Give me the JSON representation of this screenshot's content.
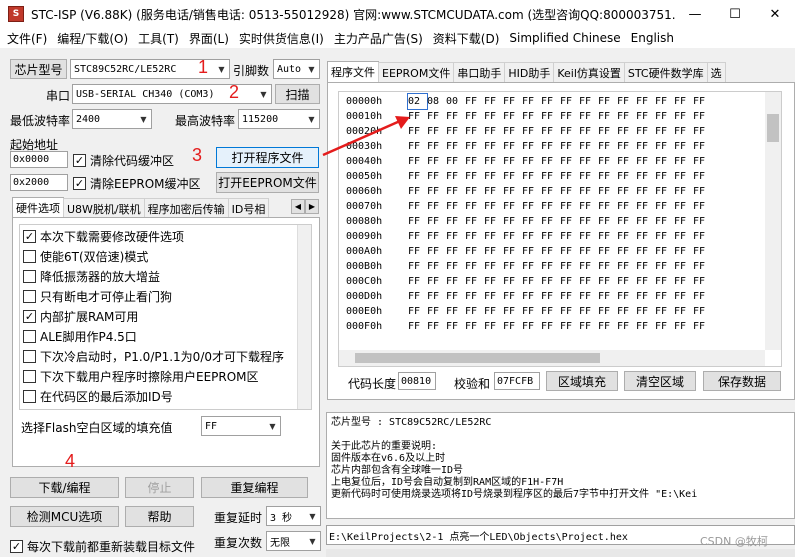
{
  "window": {
    "title": "STC-ISP (V6.88K) (服务电话/销售电话: 0513-55012928) 官网:www.STCMCUDATA.com  (选型咨询QQ:800003751...",
    "minimize": "—",
    "maximize": "☐",
    "close": "✕"
  },
  "menu": [
    "文件(F)",
    "编程/下载(O)",
    "工具(T)",
    "界面(L)",
    "实时供货信息(I)",
    "主力产品广告(S)",
    "资料下载(D)",
    "Simplified Chinese",
    "English"
  ],
  "left": {
    "chip_type_label": "芯片型号",
    "chip_type": "STC89C52RC/LE52RC",
    "pin_count_label": "引脚数",
    "pin_count": "Auto",
    "port_label": "串口",
    "port": "USB-SERIAL CH340 (COM3)",
    "scan": "扫描",
    "min_baud_label": "最低波特率",
    "min_baud": "2400",
    "max_baud_label": "最高波特率",
    "max_baud": "115200",
    "start_addr_label": "起始地址",
    "addr1": "0x0000",
    "clear_code": "清除代码缓冲区",
    "open_prog": "打开程序文件",
    "addr2": "0x2000",
    "clear_eeprom": "清除EEPROM缓冲区",
    "open_eeprom": "打开EEPROM文件",
    "tabs": [
      "硬件选项",
      "U8W脱机/联机",
      "程序加密后传输",
      "ID号相"
    ],
    "options": [
      {
        "label": "本次下载需要修改硬件选项",
        "checked": true
      },
      {
        "label": "使能6T(双倍速)模式",
        "checked": false
      },
      {
        "label": "降低振荡器的放大增益",
        "checked": false
      },
      {
        "label": "只有断电才可停止看门狗",
        "checked": false
      },
      {
        "label": "内部扩展RAM可用",
        "checked": true
      },
      {
        "label": "ALE脚用作P4.5口",
        "checked": false
      },
      {
        "label": "下次冷启动时，P1.0/P1.1为0/0才可下载程序",
        "checked": false
      },
      {
        "label": "下次下载用户程序时擦除用户EEPROM区",
        "checked": false
      },
      {
        "label": "在代码区的最后添加ID号",
        "checked": false
      }
    ],
    "fill_label": "选择Flash空白区域的填充值",
    "fill_value": "FF",
    "download": "下载/编程",
    "stop": "停止",
    "reprogram": "重复编程",
    "detect": "检测MCU选项",
    "help": "帮助",
    "delay_label": "重复延时",
    "delay": "3 秒",
    "reload": "每次下载前都重新装载目标文件",
    "count_label": "重复次数",
    "count": "无限"
  },
  "steps": [
    "1",
    "2",
    "3",
    "4"
  ],
  "right": {
    "tabs": [
      "程序文件",
      "EEPROM文件",
      "串口助手",
      "HID助手",
      "Keil仿真设置",
      "STC硬件数学库",
      "选"
    ],
    "hex_rows": [
      {
        "addr": "00000h",
        "bytes": [
          "02",
          "08",
          "00",
          "FF",
          "FF",
          "FF",
          "FF",
          "FF",
          "FF",
          "FF",
          "FF",
          "FF",
          "FF",
          "FF",
          "FF",
          "FF"
        ]
      },
      {
        "addr": "00010h",
        "bytes": [
          "FF",
          "FF",
          "FF",
          "FF",
          "FF",
          "FF",
          "FF",
          "FF",
          "FF",
          "FF",
          "FF",
          "FF",
          "FF",
          "FF",
          "FF",
          "FF"
        ]
      },
      {
        "addr": "00020h",
        "bytes": [
          "FF",
          "FF",
          "FF",
          "FF",
          "FF",
          "FF",
          "FF",
          "FF",
          "FF",
          "FF",
          "FF",
          "FF",
          "FF",
          "FF",
          "FF",
          "FF"
        ]
      },
      {
        "addr": "00030h",
        "bytes": [
          "FF",
          "FF",
          "FF",
          "FF",
          "FF",
          "FF",
          "FF",
          "FF",
          "FF",
          "FF",
          "FF",
          "FF",
          "FF",
          "FF",
          "FF",
          "FF"
        ]
      },
      {
        "addr": "00040h",
        "bytes": [
          "FF",
          "FF",
          "FF",
          "FF",
          "FF",
          "FF",
          "FF",
          "FF",
          "FF",
          "FF",
          "FF",
          "FF",
          "FF",
          "FF",
          "FF",
          "FF"
        ]
      },
      {
        "addr": "00050h",
        "bytes": [
          "FF",
          "FF",
          "FF",
          "FF",
          "FF",
          "FF",
          "FF",
          "FF",
          "FF",
          "FF",
          "FF",
          "FF",
          "FF",
          "FF",
          "FF",
          "FF"
        ]
      },
      {
        "addr": "00060h",
        "bytes": [
          "FF",
          "FF",
          "FF",
          "FF",
          "FF",
          "FF",
          "FF",
          "FF",
          "FF",
          "FF",
          "FF",
          "FF",
          "FF",
          "FF",
          "FF",
          "FF"
        ]
      },
      {
        "addr": "00070h",
        "bytes": [
          "FF",
          "FF",
          "FF",
          "FF",
          "FF",
          "FF",
          "FF",
          "FF",
          "FF",
          "FF",
          "FF",
          "FF",
          "FF",
          "FF",
          "FF",
          "FF"
        ]
      },
      {
        "addr": "00080h",
        "bytes": [
          "FF",
          "FF",
          "FF",
          "FF",
          "FF",
          "FF",
          "FF",
          "FF",
          "FF",
          "FF",
          "FF",
          "FF",
          "FF",
          "FF",
          "FF",
          "FF"
        ]
      },
      {
        "addr": "00090h",
        "bytes": [
          "FF",
          "FF",
          "FF",
          "FF",
          "FF",
          "FF",
          "FF",
          "FF",
          "FF",
          "FF",
          "FF",
          "FF",
          "FF",
          "FF",
          "FF",
          "FF"
        ]
      },
      {
        "addr": "000A0h",
        "bytes": [
          "FF",
          "FF",
          "FF",
          "FF",
          "FF",
          "FF",
          "FF",
          "FF",
          "FF",
          "FF",
          "FF",
          "FF",
          "FF",
          "FF",
          "FF",
          "FF"
        ]
      },
      {
        "addr": "000B0h",
        "bytes": [
          "FF",
          "FF",
          "FF",
          "FF",
          "FF",
          "FF",
          "FF",
          "FF",
          "FF",
          "FF",
          "FF",
          "FF",
          "FF",
          "FF",
          "FF",
          "FF"
        ]
      },
      {
        "addr": "000C0h",
        "bytes": [
          "FF",
          "FF",
          "FF",
          "FF",
          "FF",
          "FF",
          "FF",
          "FF",
          "FF",
          "FF",
          "FF",
          "FF",
          "FF",
          "FF",
          "FF",
          "FF"
        ]
      },
      {
        "addr": "000D0h",
        "bytes": [
          "FF",
          "FF",
          "FF",
          "FF",
          "FF",
          "FF",
          "FF",
          "FF",
          "FF",
          "FF",
          "FF",
          "FF",
          "FF",
          "FF",
          "FF",
          "FF"
        ]
      },
      {
        "addr": "000E0h",
        "bytes": [
          "FF",
          "FF",
          "FF",
          "FF",
          "FF",
          "FF",
          "FF",
          "FF",
          "FF",
          "FF",
          "FF",
          "FF",
          "FF",
          "FF",
          "FF",
          "FF"
        ]
      },
      {
        "addr": "000F0h",
        "bytes": [
          "FF",
          "FF",
          "FF",
          "FF",
          "FF",
          "FF",
          "FF",
          "FF",
          "FF",
          "FF",
          "FF",
          "FF",
          "FF",
          "FF",
          "FF",
          "FF"
        ]
      }
    ],
    "code_len_label": "代码长度",
    "code_len": "00810",
    "checksum_label": "校验和",
    "checksum": "07FCFB",
    "fill_area": "区域填充",
    "clear_area": "清空区域",
    "save": "保存数据",
    "info_lines": [
      "芯片型号 : STC89C52RC/LE52RC",
      "",
      "关于此芯片的重要说明:",
      "  固件版本在v6.6及以上时",
      "    芯片内部包含有全球唯一ID号",
      "    上电复位后，ID号会自动复制到RAM区域的F1H-F7H",
      "    更新代码时可使用烧录选项将ID号烧录到程序区的最后7字节中打开文件 \"E:\\Kei"
    ],
    "file_path": "E:\\KeilProjects\\2-1 点亮一个LED\\Objects\\Project.hex"
  },
  "watermark": "CSDN @牧柯"
}
